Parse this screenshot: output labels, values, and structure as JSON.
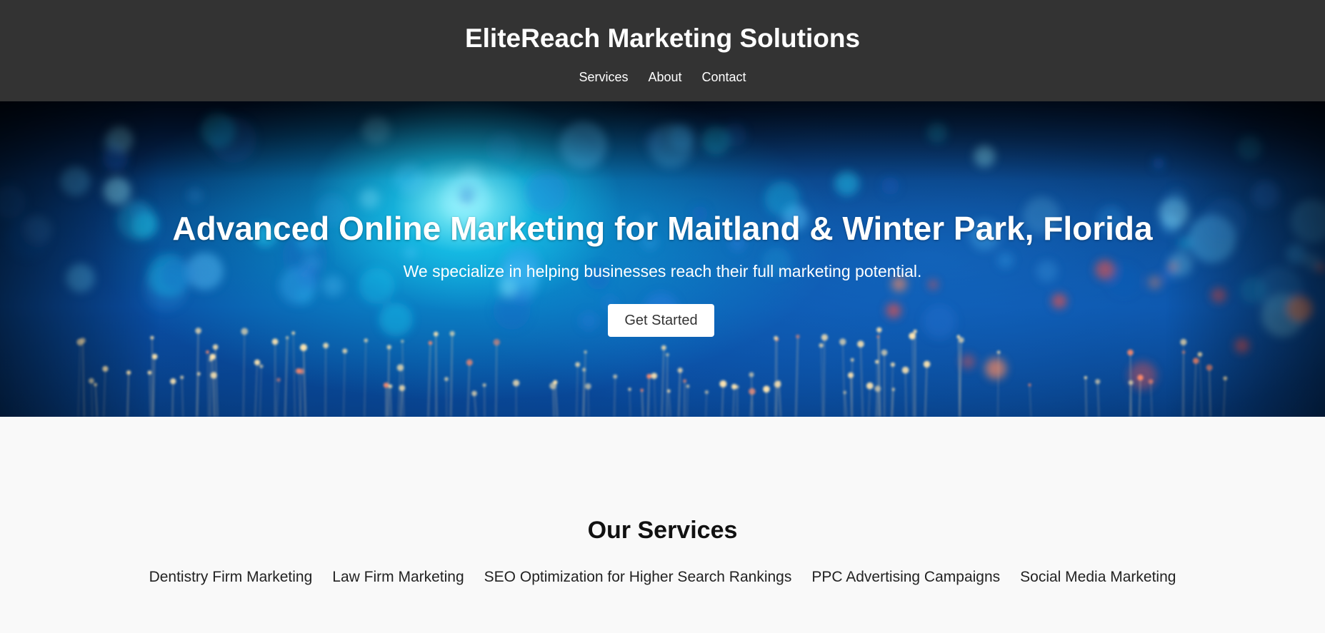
{
  "header": {
    "brand": "EliteReach Marketing Solutions",
    "nav": [
      {
        "label": "Services"
      },
      {
        "label": "About"
      },
      {
        "label": "Contact"
      }
    ]
  },
  "hero": {
    "title": "Advanced Online Marketing for Maitland & Winter Park, Florida",
    "subtitle": "We specialize in helping businesses reach their full marketing potential.",
    "cta_label": "Get Started"
  },
  "services": {
    "title": "Our Services",
    "items": [
      {
        "label": "Dentistry Firm Marketing"
      },
      {
        "label": "Law Firm Marketing"
      },
      {
        "label": "SEO Optimization for Higher Search Rankings"
      },
      {
        "label": "PPC Advertising Campaigns"
      },
      {
        "label": "Social Media Marketing"
      }
    ]
  },
  "colors": {
    "header_bg": "#333333",
    "page_bg": "#f9f9f9",
    "hero_accent": "#12c8f0"
  }
}
